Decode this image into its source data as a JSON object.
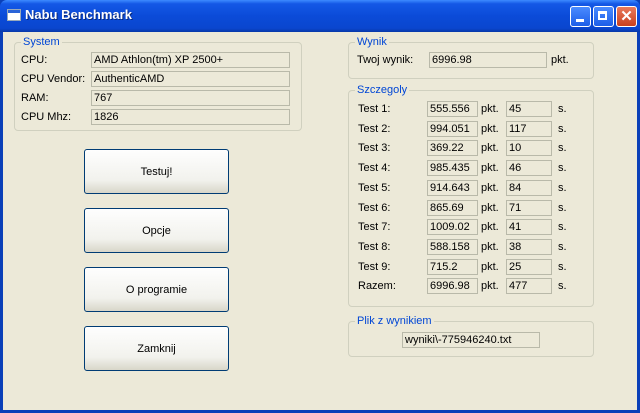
{
  "window": {
    "title": "Nabu Benchmark"
  },
  "system": {
    "title": "System",
    "cpu_label": "CPU:",
    "cpu": "AMD Athlon(tm) XP 2500+",
    "vendor_label": "CPU Vendor:",
    "vendor": "AuthenticAMD",
    "ram_label": "RAM:",
    "ram": "767",
    "mhz_label": "CPU Mhz:",
    "mhz": "1826"
  },
  "buttons": {
    "testuj": "Testuj!",
    "opcje": "Opcje",
    "o_programie": "O programie",
    "zamknij": "Zamknij"
  },
  "wynik": {
    "title": "Wynik",
    "label": "Twoj wynik:",
    "value": "6996.98",
    "unit": "pkt."
  },
  "szczegoly": {
    "title": "Szczegoly",
    "pkt": "pkt.",
    "s": "s.",
    "rows": [
      {
        "label": "Test 1:",
        "score": "555.556",
        "time": "45"
      },
      {
        "label": "Test 2:",
        "score": "994.051",
        "time": "117"
      },
      {
        "label": "Test 3:",
        "score": "369.22",
        "time": "10"
      },
      {
        "label": "Test 4:",
        "score": "985.435",
        "time": "46"
      },
      {
        "label": "Test 5:",
        "score": "914.643",
        "time": "84"
      },
      {
        "label": "Test 6:",
        "score": "865.69",
        "time": "71"
      },
      {
        "label": "Test 7:",
        "score": "1009.02",
        "time": "41"
      },
      {
        "label": "Test 8:",
        "score": "588.158",
        "time": "38"
      },
      {
        "label": "Test 9:",
        "score": "715.2",
        "time": "25"
      },
      {
        "label": "Razem:",
        "score": "6996.98",
        "time": "477"
      }
    ]
  },
  "plik": {
    "title": "Plik z wynikiem",
    "value": "wyniki\\-775946240.txt"
  }
}
